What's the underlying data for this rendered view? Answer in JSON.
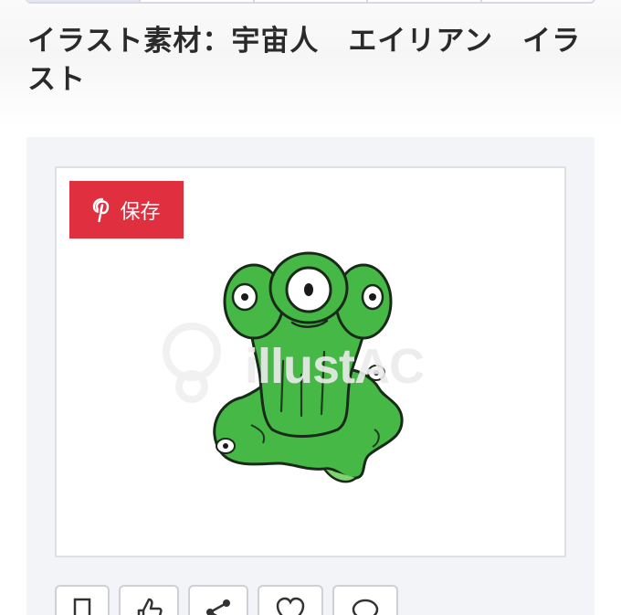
{
  "page": {
    "title": "イラスト素材：宇宙人　エイリアン　イラスト"
  },
  "pin_button": {
    "label": "保存",
    "icon": "pinterest-icon",
    "color": "#e0303f"
  },
  "illustration": {
    "watermark": "illustAC",
    "accent_color": "#46b846"
  },
  "actions": [
    {
      "icon": "bookmark-icon"
    },
    {
      "icon": "thumbs-up-icon"
    },
    {
      "icon": "share-icon"
    },
    {
      "icon": "heart-icon"
    },
    {
      "icon": "comment-icon"
    }
  ]
}
